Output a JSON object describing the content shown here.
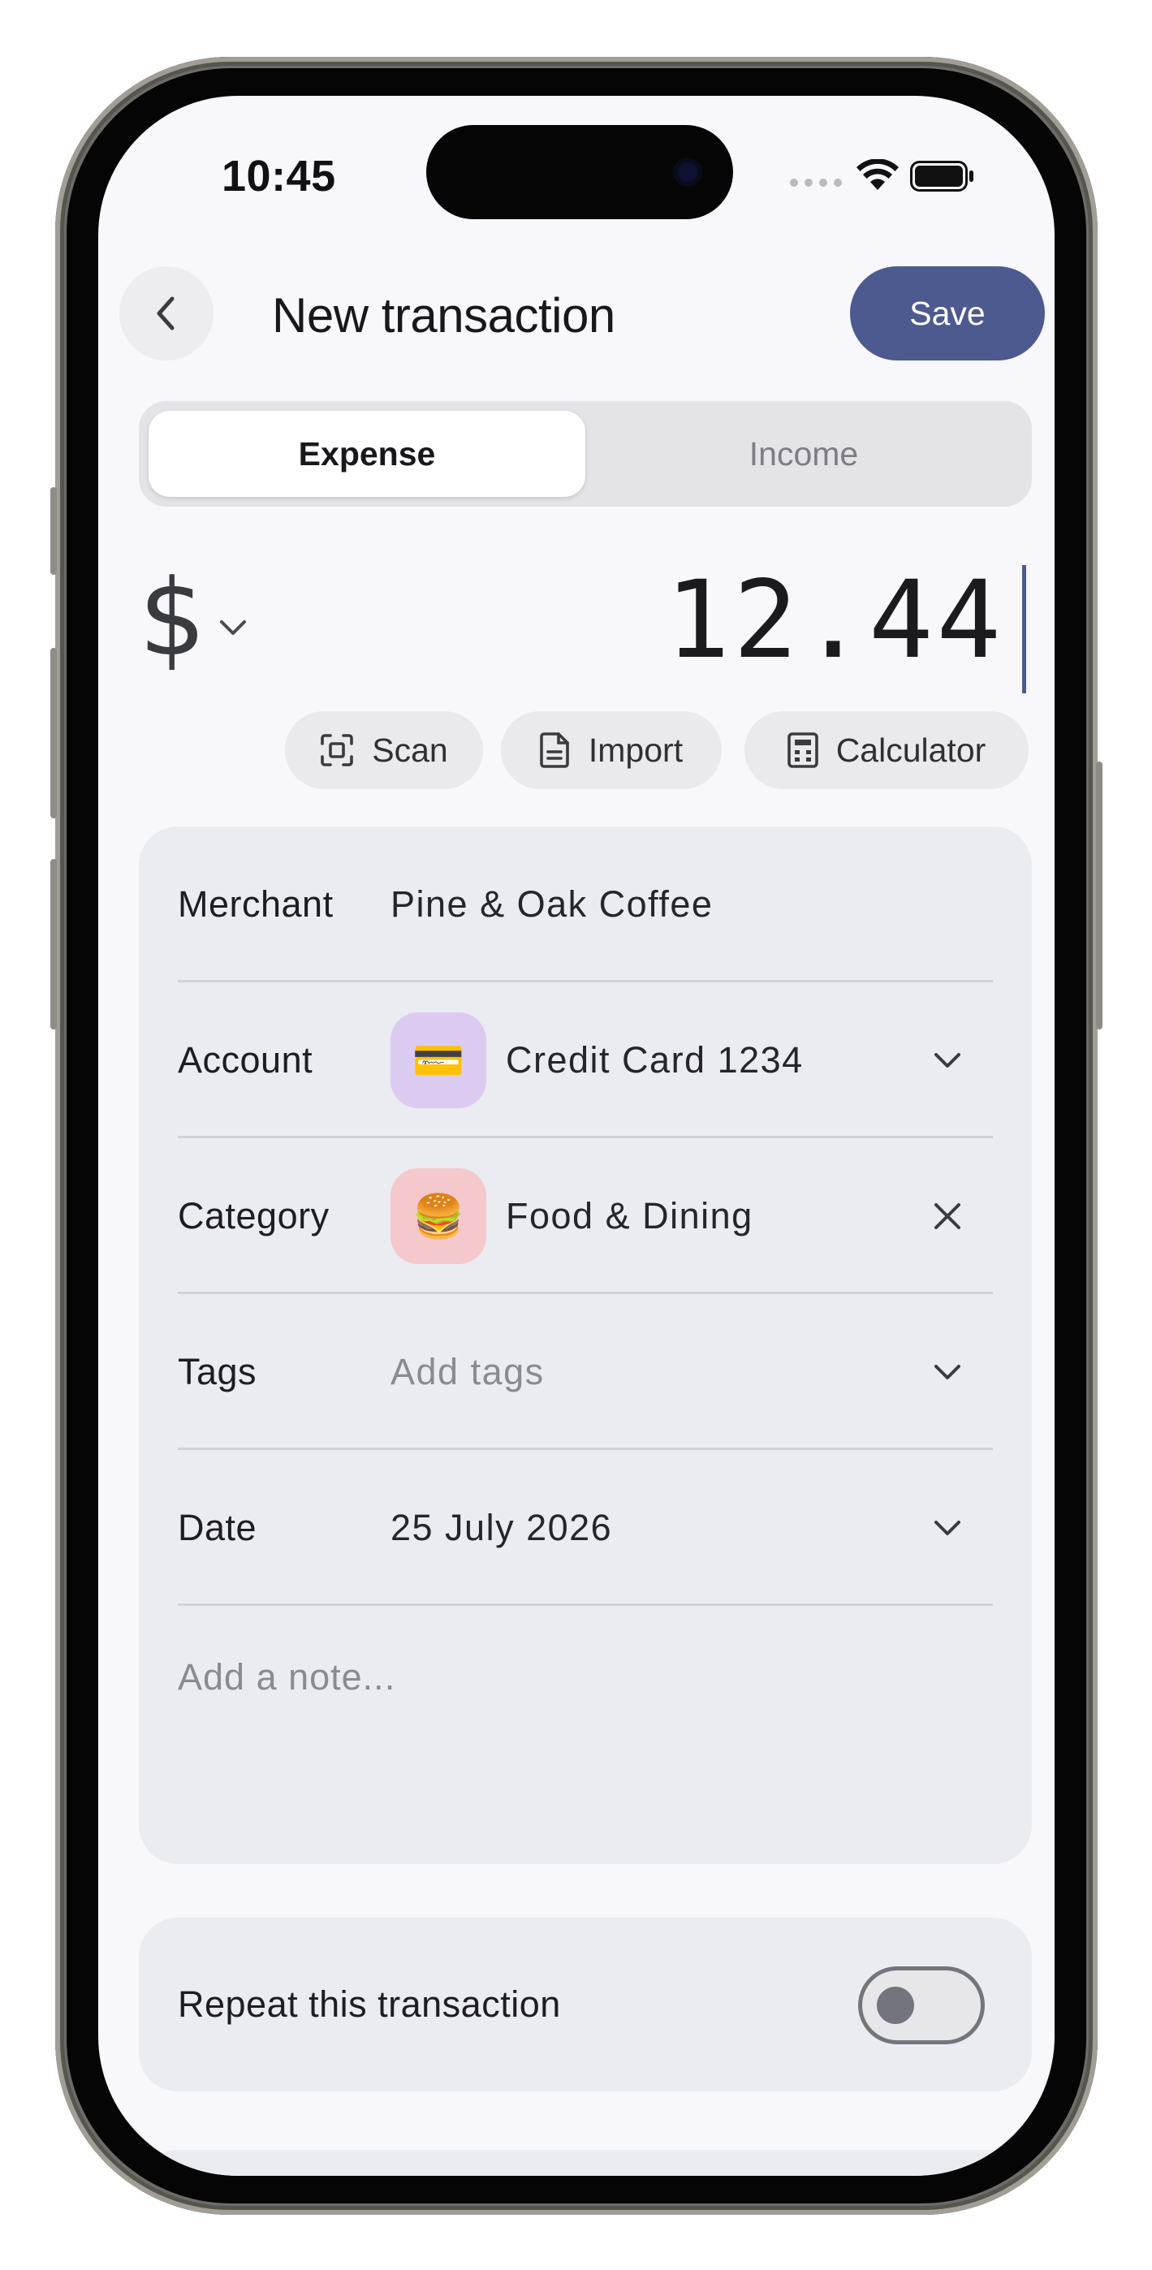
{
  "status_bar": {
    "time": "10:45"
  },
  "header": {
    "back_icon": "chevron-left-icon",
    "title": "New transaction",
    "save_label": "Save"
  },
  "type_toggle": {
    "options": [
      "Expense",
      "Income"
    ],
    "selected": "Expense"
  },
  "amount": {
    "currency_symbol": "$",
    "value": "12.44"
  },
  "actions": [
    {
      "icon": "scan-icon",
      "label": "Scan"
    },
    {
      "icon": "document-icon",
      "label": "Import"
    },
    {
      "icon": "calculator-icon",
      "label": "Calculator"
    }
  ],
  "form": {
    "merchant": {
      "label": "Merchant",
      "value": "Pine & Oak Coffee"
    },
    "account": {
      "label": "Account",
      "icon": "💳",
      "icon_bg": "#dccbf0",
      "value": "Credit Card 1234"
    },
    "category": {
      "label": "Category",
      "icon": "🍔",
      "icon_bg": "#f5c8cc",
      "value": "Food & Dining"
    },
    "tags": {
      "label": "Tags",
      "placeholder": "Add tags"
    },
    "date": {
      "label": "Date",
      "value": "25 July 2026"
    },
    "note": {
      "placeholder": "Add a note..."
    }
  },
  "repeat": {
    "label": "Repeat this transaction",
    "enabled": false
  },
  "colors": {
    "accent": "#4d5a8f",
    "background": "#f7f7fc",
    "card": "#ebebf2"
  }
}
